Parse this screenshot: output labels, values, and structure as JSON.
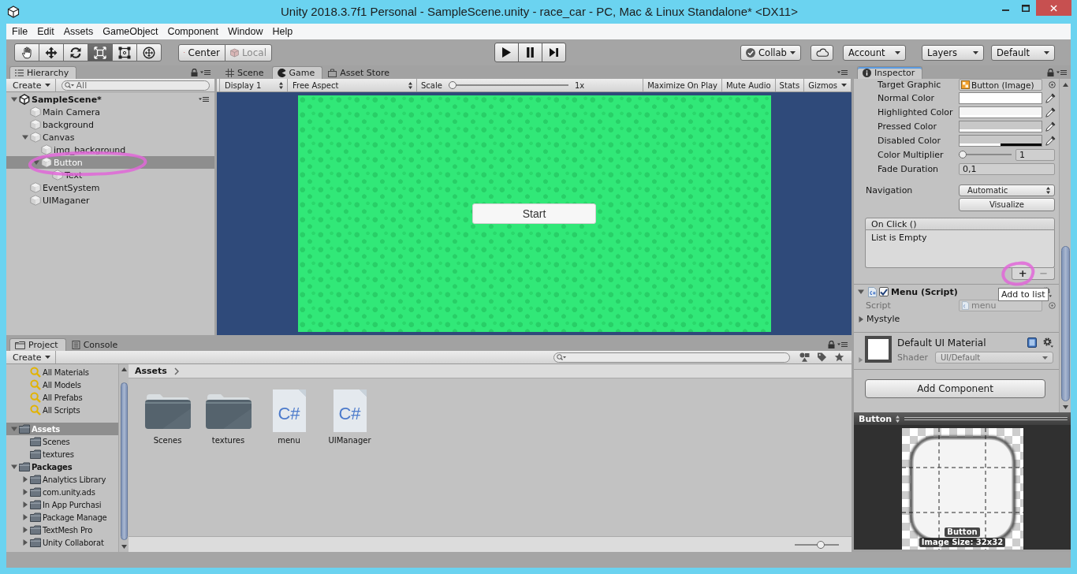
{
  "window": {
    "title": "Unity 2018.3.7f1 Personal - SampleScene.unity - race_car - PC, Mac & Linux Standalone* <DX11>"
  },
  "menu": [
    "File",
    "Edit",
    "Assets",
    "GameObject",
    "Component",
    "Window",
    "Help"
  ],
  "toolbar": {
    "tools": [
      {
        "kind": "hand",
        "selected": false
      },
      {
        "kind": "move",
        "selected": false
      },
      {
        "kind": "rotate",
        "selected": false
      },
      {
        "kind": "scale",
        "selected": true
      },
      {
        "kind": "rect",
        "selected": false
      },
      {
        "kind": "transform",
        "selected": false
      }
    ],
    "pivot": {
      "label": "Center",
      "disabled": false
    },
    "rotation": {
      "label": "Local",
      "disabled": true
    },
    "collab": "Collab",
    "account": "Account",
    "layers": "Layers",
    "layout": "Default"
  },
  "hierarchy": {
    "tab": "Hierarchy",
    "create": "Create",
    "search": {
      "placeholder": "All"
    },
    "tree": [
      {
        "label": "SampleScene*",
        "kind": "scene",
        "selected": false,
        "expanded": true,
        "children": [
          {
            "label": "Main Camera",
            "kind": "object",
            "selected": false
          },
          {
            "label": "background",
            "kind": "object",
            "selected": false
          },
          {
            "label": "Canvas",
            "kind": "object",
            "selected": false,
            "expanded": true,
            "children": [
              {
                "label": "img_background",
                "kind": "object",
                "selected": false
              },
              {
                "label": "Button",
                "kind": "object",
                "selected": true,
                "expanded": true,
                "children": [
                  {
                    "label": "Text",
                    "kind": "object",
                    "selected": false
                  }
                ]
              }
            ]
          },
          {
            "label": "EventSystem",
            "kind": "object",
            "selected": false
          },
          {
            "label": "UIMaganer",
            "kind": "object",
            "selected": false
          }
        ]
      }
    ]
  },
  "game": {
    "tabs": [
      {
        "label": "Scene",
        "kind": "scene",
        "selected": false
      },
      {
        "label": "Game",
        "kind": "game",
        "selected": true
      },
      {
        "label": "Asset Store",
        "kind": "store",
        "selected": false
      }
    ],
    "display": "Display 1",
    "aspect": "Free Aspect",
    "scale": {
      "label": "Scale",
      "level": 0,
      "reading": "1x"
    },
    "toggles": [
      {
        "label": "Maximize On Play",
        "kind": "toggle",
        "on": false
      },
      {
        "label": "Mute Audio",
        "kind": "toggle",
        "on": false
      },
      {
        "label": "Stats",
        "kind": "toggle",
        "on": false
      },
      {
        "label": "Gizmos",
        "kind": "dropdown",
        "on": false
      }
    ],
    "start_button": "Start"
  },
  "inspector": {
    "tab": "Inspector",
    "transition_fields": [
      {
        "kind": "object",
        "label": "Target Graphic",
        "value": "Button (Image)"
      },
      {
        "kind": "color",
        "label": "Normal Color",
        "color": "#ffffff",
        "level": 1
      },
      {
        "kind": "color",
        "label": "Highlighted Color",
        "color": "#f5f5f5",
        "level": 1
      },
      {
        "kind": "color",
        "label": "Pressed Color",
        "color": "#c8c8c8",
        "level": 1
      },
      {
        "kind": "color",
        "label": "Disabled Color",
        "color": "#c8c8c8",
        "level": 0.5
      },
      {
        "kind": "slider",
        "label": "Color Multiplier",
        "level": 0,
        "value": "1"
      },
      {
        "kind": "number",
        "label": "Fade Duration",
        "value": "0,1"
      }
    ],
    "navigation": {
      "label": "Navigation",
      "value": "Automatic"
    },
    "visualize": "Visualize",
    "on_click": {
      "header": "On Click ()",
      "empty_text": "List is Empty",
      "add": "+",
      "remove": {
        "label": "−",
        "disabled": true
      },
      "tooltip": "Add to list"
    },
    "component": {
      "title": "Menu (Script)",
      "enabled": true,
      "expanded": true,
      "script_label": "Script",
      "script_value": "menu",
      "foldouts": [
        {
          "label": "Mystyle",
          "expanded": false
        }
      ]
    },
    "material": {
      "name": "Default UI Material",
      "shader_label": "Shader",
      "shader": "UI/Default"
    },
    "add_component": "Add Component"
  },
  "preview": {
    "title": "Button",
    "caption": "Button",
    "info": "Image Size: 32x32"
  },
  "project": {
    "tabs": [
      {
        "label": "Project",
        "kind": "project",
        "selected": true
      },
      {
        "label": "Console",
        "kind": "console",
        "selected": false
      }
    ],
    "create": "Create",
    "favorites": [
      {
        "label": "All Materials",
        "selected": false
      },
      {
        "label": "All Models",
        "selected": false
      },
      {
        "label": "All Prefabs",
        "selected": false
      },
      {
        "label": "All Scripts",
        "selected": false
      }
    ],
    "tree": [
      {
        "label": "Assets",
        "selected": true,
        "expanded": true,
        "children": [
          {
            "label": "Scenes",
            "selected": false
          },
          {
            "label": "textures",
            "selected": false
          }
        ]
      },
      {
        "label": "Packages",
        "selected": false,
        "expanded": true,
        "children": [
          {
            "label": "Analytics Library",
            "selected": false,
            "expanded": false
          },
          {
            "label": "com.unity.ads",
            "selected": false,
            "expanded": false
          },
          {
            "label": "In App Purchasi",
            "selected": false,
            "expanded": false
          },
          {
            "label": "Package Manage",
            "selected": false,
            "expanded": false
          },
          {
            "label": "TextMesh Pro",
            "selected": false,
            "expanded": false
          },
          {
            "label": "Unity Collaborat",
            "selected": false,
            "expanded": false
          }
        ]
      }
    ],
    "breadcrumb": "Assets",
    "items": [
      {
        "label": "Scenes",
        "kind": "folder",
        "selected": false
      },
      {
        "label": "textures",
        "kind": "folder",
        "selected": false
      },
      {
        "label": "menu",
        "kind": "script",
        "badge": "C#",
        "selected": false
      },
      {
        "label": "UIManager",
        "kind": "script",
        "badge": "C#",
        "selected": false
      }
    ],
    "icon_size": {
      "level": 0.6
    }
  }
}
